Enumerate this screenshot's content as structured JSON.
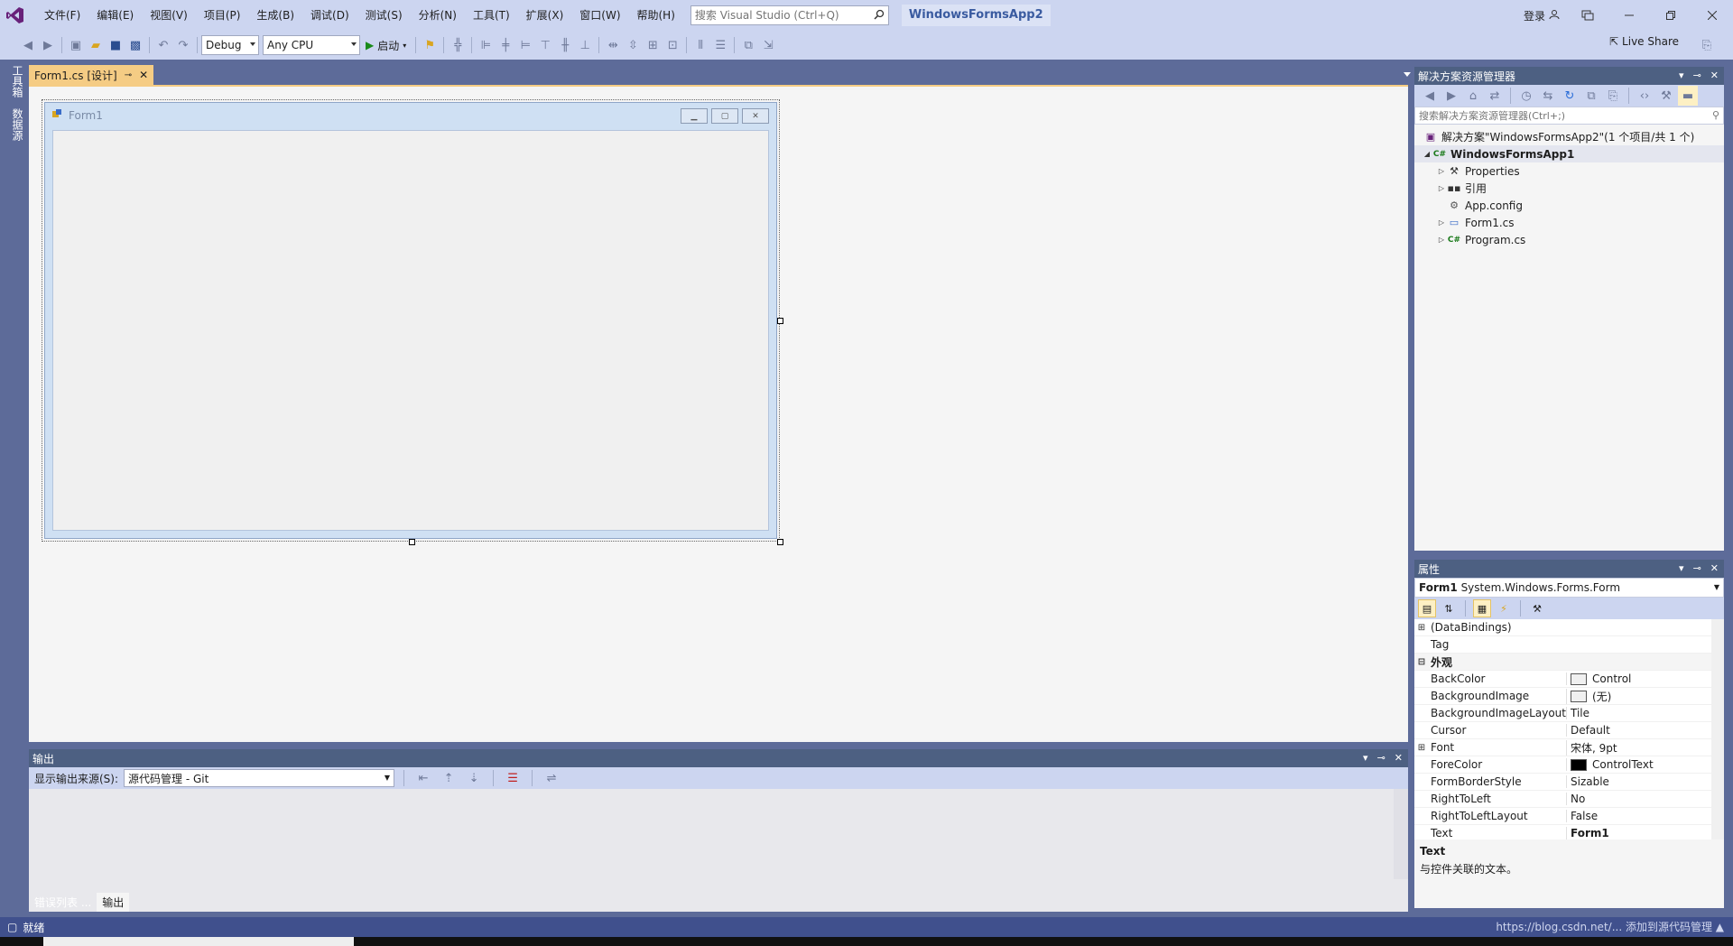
{
  "titlebar": {
    "menu": [
      "文件(F)",
      "编辑(E)",
      "视图(V)",
      "项目(P)",
      "生成(B)",
      "调试(D)",
      "测试(S)",
      "分析(N)",
      "工具(T)",
      "扩展(X)",
      "窗口(W)",
      "帮助(H)"
    ],
    "search_placeholder": "搜索 Visual Studio (Ctrl+Q)",
    "solution_name": "WindowsFormsApp2",
    "signin": "登录"
  },
  "toolbar": {
    "config": "Debug",
    "platform": "Any CPU",
    "start": "启动",
    "liveshare": "Live Share"
  },
  "left_strip": {
    "toolbox": "工具箱",
    "datasources": "数据源"
  },
  "document": {
    "tab_label": "Form1.cs [设计]",
    "form_title": "Form1"
  },
  "solution_explorer": {
    "title": "解决方案资源管理器",
    "search_placeholder": "搜索解决方案资源管理器(Ctrl+;)",
    "solution_label": "解决方案\"WindowsFormsApp2\"(1 个项目/共 1 个)",
    "project": "WindowsFormsApp1",
    "items": [
      {
        "label": "Properties",
        "icon": "wrench-icon"
      },
      {
        "label": "引用",
        "icon": "references-icon"
      },
      {
        "label": "App.config",
        "icon": "config-file-icon"
      },
      {
        "label": "Form1.cs",
        "icon": "form-icon"
      },
      {
        "label": "Program.cs",
        "icon": "csharp-file-icon"
      }
    ]
  },
  "properties": {
    "title": "属性",
    "object": "Form1",
    "object_type": "System.Windows.Forms.Form",
    "rows": [
      {
        "name": "(DataBindings)",
        "value": ""
      },
      {
        "name": "Tag",
        "value": ""
      },
      {
        "name": "外观",
        "value": ""
      },
      {
        "name": "BackColor",
        "value": "Control"
      },
      {
        "name": "BackgroundImage",
        "value": "(无)"
      },
      {
        "name": "BackgroundImageLayout",
        "value": "Tile"
      },
      {
        "name": "Cursor",
        "value": "Default"
      },
      {
        "name": "Font",
        "value": "宋体, 9pt"
      },
      {
        "name": "ForeColor",
        "value": "ControlText"
      },
      {
        "name": "FormBorderStyle",
        "value": "Sizable"
      },
      {
        "name": "RightToLeft",
        "value": "No"
      },
      {
        "name": "RightToLeftLayout",
        "value": "False"
      },
      {
        "name": "Text",
        "value": "Form1"
      }
    ],
    "desc_title": "Text",
    "desc_text": "与控件关联的文本。"
  },
  "output": {
    "title": "输出",
    "source_label": "显示输出来源(S):",
    "source_value": "源代码管理 - Git",
    "tabs": [
      "错误列表 ...",
      "输出"
    ]
  },
  "status": {
    "ready": "就绪",
    "right": "https://blog.csdn.net/... 添加到源代码管理 ▲"
  },
  "colors": {
    "accent": "#5d6b99",
    "doc_tab": "#f5cc84",
    "status": "#40508d"
  }
}
